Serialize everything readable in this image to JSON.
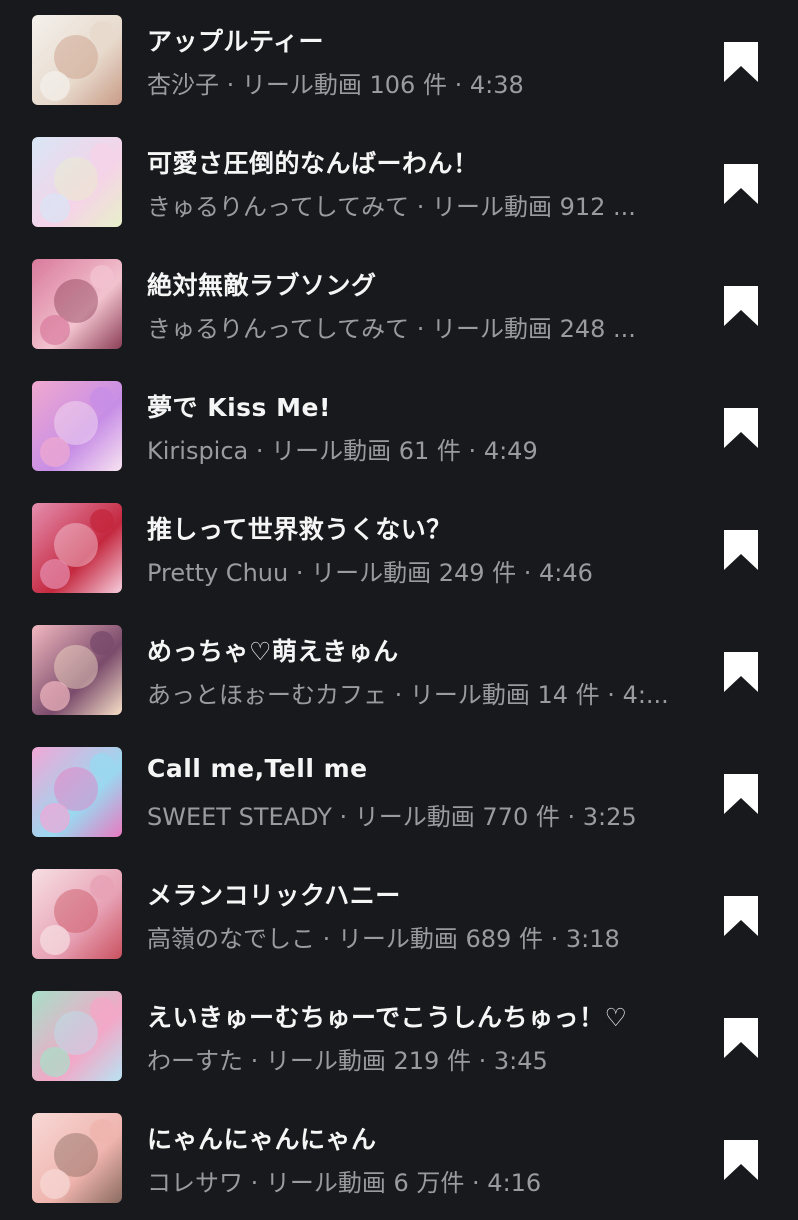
{
  "songs": [
    {
      "title": "アップルティー",
      "meta": "杏沙子 · リール動画 106 件 · 4:38",
      "colors": [
        "#f4f1ec",
        "#e7d9cc",
        "#c99b86"
      ]
    },
    {
      "title": "可愛さ圧倒的なんばーわん！",
      "meta": "きゅるりんってしてみて · リール動画 912 ...",
      "colors": [
        "#d8e6f5",
        "#f5d3e8",
        "#e8f0c9"
      ]
    },
    {
      "title": "絶対無敵ラブソング",
      "meta": "きゅるりんってしてみて · リール動画 248 ...",
      "colors": [
        "#d97a9c",
        "#f2c2cf",
        "#8b3f56"
      ]
    },
    {
      "title": "夢で Kiss Me!",
      "meta": "Kirispica · リール動画 61 件 · 4:49",
      "colors": [
        "#f0a9cf",
        "#c78ee6",
        "#f7e3f1"
      ]
    },
    {
      "title": "推しって世界救うくない？",
      "meta": "Pretty Chuu · リール動画 249 件 · 4:46",
      "colors": [
        "#e58fb0",
        "#c4283f",
        "#f6cede"
      ]
    },
    {
      "title": "めっちゃ♡萌えきゅん",
      "meta": "あっとほぉーむカフェ · リール動画 14 件 · 4:...",
      "colors": [
        "#f2b8c0",
        "#7a4b6b",
        "#f7e0c8"
      ]
    },
    {
      "title": "Call me,Tell me",
      "meta": "SWEET STEADY · リール動画 770 件 · 3:25",
      "colors": [
        "#f1a7d6",
        "#9ad8f0",
        "#e87ac0"
      ]
    },
    {
      "title": "メランコリックハニー",
      "meta": "高嶺のなでしこ · リール動画 689 件 · 3:18",
      "colors": [
        "#f7dfe4",
        "#e7a1b5",
        "#c9515f"
      ]
    },
    {
      "title": "えいきゅーむちゅーでこうしんちゅっ！♡",
      "meta": "わーすた · リール動画 219 件 · 3:45",
      "colors": [
        "#a7dfc9",
        "#f3a7c6",
        "#b8e2f2"
      ]
    },
    {
      "title": "にゃんにゃんにゃん",
      "meta": "コレサワ · リール動画 6 万件 · 4:16",
      "colors": [
        "#f7d9d6",
        "#efb4ae",
        "#8a6b5f"
      ]
    }
  ]
}
